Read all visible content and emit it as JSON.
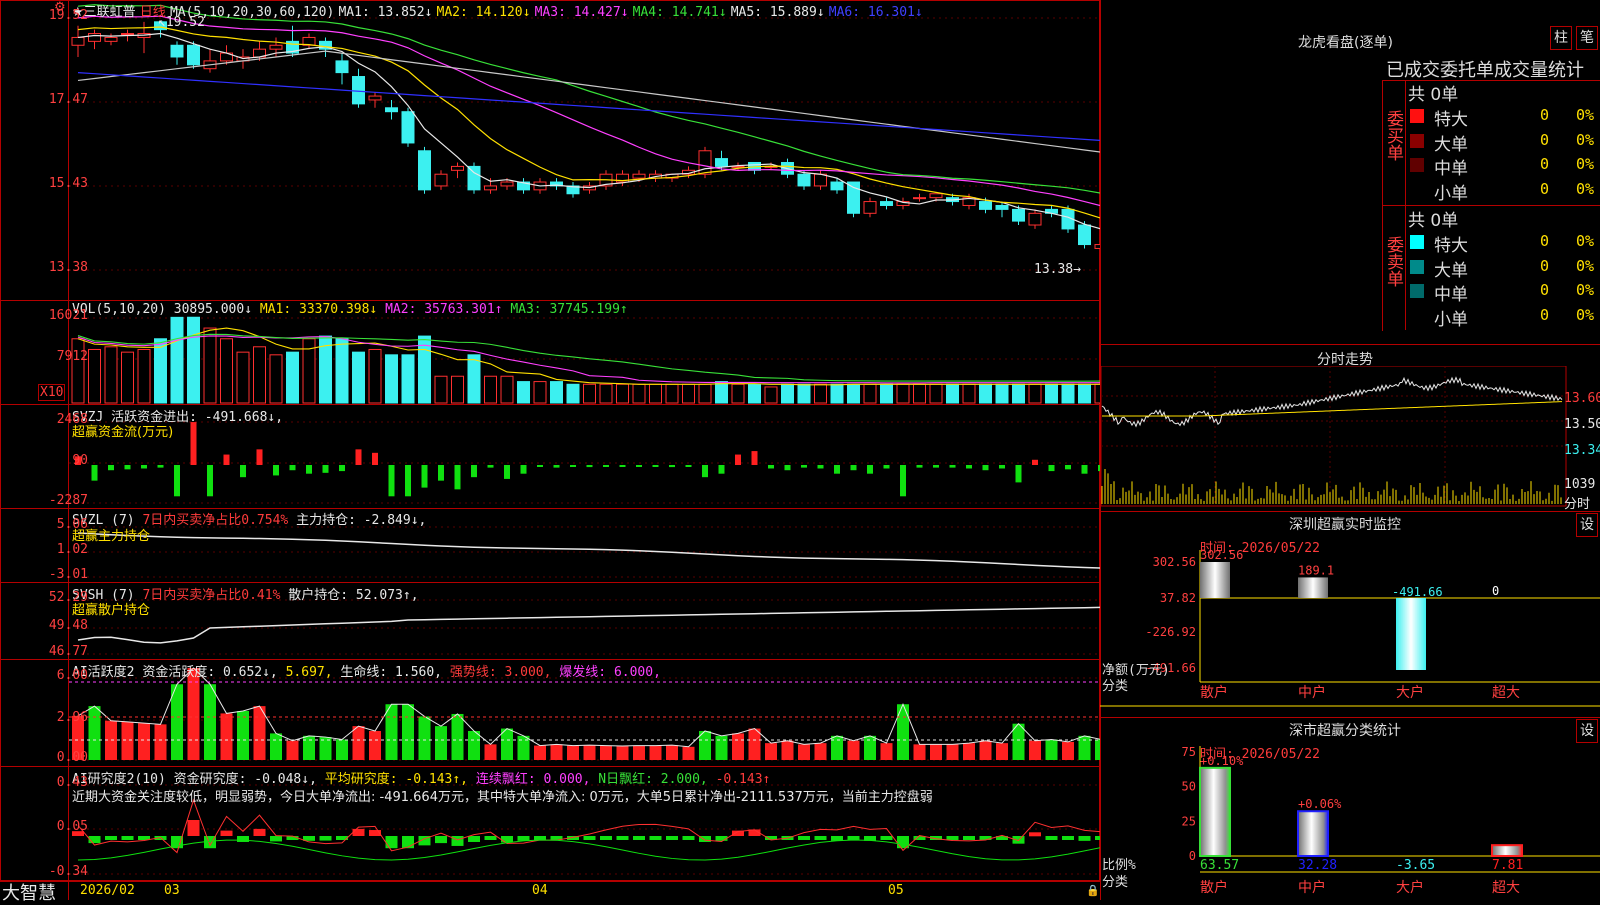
{
  "app": {
    "brand": "大智慧",
    "stock_name": "三联虹普",
    "period": "日线"
  },
  "main": {
    "ma_header": {
      "label": "MA(5,10,20,30,60,120)",
      "ma1": "MA1: 13.852↓",
      "ma2": "MA2: 14.120↓",
      "ma3": "MA3: 14.427↓",
      "ma4": "MA4: 14.741↓",
      "ma5": "MA5: 15.889↓",
      "ma6": "MA6: 16.301↓"
    },
    "y_ticks": [
      "19.52",
      "17.47",
      "15.43",
      "13.38"
    ],
    "high_label": "19.52",
    "low_label": "13.38→"
  },
  "vol": {
    "header": {
      "label": "VOL(5,10,20)",
      "value": "30895.000↓",
      "ma1": "MA1: 33370.398↓",
      "ma2": "MA2: 35763.301↑",
      "ma3": "MA3: 37745.199↑"
    },
    "y_ticks": [
      "16021",
      "7912"
    ],
    "unit": "X10"
  },
  "svzj": {
    "header": {
      "label": "SVZJ",
      "text": "活跃资金进出: -491.668↓,",
      "sub": "超赢资金流(万元)"
    },
    "y_ticks": [
      "2468",
      "90",
      "-2287"
    ]
  },
  "svzl": {
    "header": {
      "label": "SVZL (7)",
      "pct": "7日内买卖净占比0.754%",
      "text": "主力持仓: -2.849↓,",
      "sub": "超赢主力持仓"
    },
    "y_ticks": [
      "5.06",
      "1.02",
      "-3.01"
    ]
  },
  "svsh": {
    "header": {
      "label": "SVSH (7)",
      "pct": "7日内买卖净占比0.41%",
      "text": "散户持仓: 52.073↑,",
      "sub": "超赢散户持仓"
    },
    "y_ticks": [
      "52.29",
      "49.48",
      "46.77"
    ]
  },
  "ai2": {
    "header": {
      "label": "AI活跃度2",
      "t1": "资金活跃度: 0.652↓,",
      "t2": "5.697,",
      "t3": "生命线: 1.560,",
      "t4": "强势线: 3.000,",
      "t5": "爆发线: 6.000,"
    },
    "y_ticks": [
      "6.00",
      "2.96",
      "0.00"
    ]
  },
  "ai_research": {
    "header": {
      "label": "AI研究度2(10)",
      "t1": "资金研究度: -0.048↓,",
      "t2": "平均研究度: -0.143↑,",
      "t3": "连续飘红: 0.000,",
      "t4": "N日飘红: 2.000,",
      "t5": "-0.143↑"
    },
    "comment": "近期大资金关注度较低，明显弱势，今日大单净流出: -491.664万元，其中特大单净流入: 0万元，大单5日累计净出-2111.537万元，当前主力控盘弱",
    "y_ticks": [
      "0.43",
      "0.05",
      "-0.34"
    ]
  },
  "date_axis": [
    "2026/02",
    "03",
    "04",
    "05"
  ],
  "right": {
    "dragon": {
      "title": "龙虎看盘(逐单)",
      "tab1": "柱",
      "tab2": "笔",
      "subtitle": "已成交委托单成交量统计",
      "buy": {
        "side": "委买单",
        "total": "共 0单",
        "rows": [
          {
            "name": "特大",
            "count": "0",
            "pct": "0%",
            "color": "#ff1010"
          },
          {
            "name": "大单",
            "count": "0",
            "pct": "0%",
            "color": "#8a0000"
          },
          {
            "name": "中单",
            "count": "0",
            "pct": "0%",
            "color": "#600000"
          },
          {
            "name": "小单",
            "count": "0",
            "pct": "0%",
            "color": "#000000"
          }
        ]
      },
      "sell": {
        "side": "委卖单",
        "total": "共 0单",
        "rows": [
          {
            "name": "特大",
            "count": "0",
            "pct": "0%",
            "color": "#00ffff"
          },
          {
            "name": "大单",
            "count": "0",
            "pct": "0%",
            "color": "#008a8a"
          },
          {
            "name": "中单",
            "count": "0",
            "pct": "0%",
            "color": "#006a6a"
          },
          {
            "name": "小单",
            "count": "0",
            "pct": "0%",
            "color": "#000000"
          }
        ]
      }
    },
    "intraday": {
      "title": "分时走势",
      "price_ticks": [
        "13.60",
        "13.50",
        "13.34"
      ],
      "vol_tick": "1039",
      "vol_label": "分时"
    },
    "monitor": {
      "title": "深圳超赢实时监控",
      "set": "设",
      "time": "时间: 2026/05/22",
      "y_ticks": [
        "302.56",
        "37.82",
        "-226.92",
        "-491.66"
      ],
      "ylabel1": "净额(万元)",
      "ylabel2": "分类",
      "categories": [
        "散户",
        "中户",
        "大户",
        "超大"
      ],
      "values": [
        302.56,
        189.1,
        -491.66,
        0
      ],
      "value_labels": [
        "302.56",
        "189.1",
        "-491.66",
        "0"
      ]
    },
    "classify": {
      "title": "深市超赢分类统计",
      "set": "设",
      "time": "时间: 2026/05/22",
      "y_ticks": [
        "75",
        "50",
        "25",
        "0"
      ],
      "ylabel1": "比例%",
      "ylabel2": "分类",
      "categories": [
        "散户",
        "中户",
        "大户",
        "超大"
      ],
      "values": [
        63.57,
        32.28,
        -3.65,
        7.81
      ],
      "value_labels": [
        "63.57",
        "32.28",
        "-3.65",
        "7.81"
      ],
      "top_labels": [
        "+0.10%",
        "+0.06%",
        "",
        ""
      ]
    }
  },
  "chart_data": [
    {
      "type": "candlestick",
      "title": "三联虹普 日线",
      "ylim": [
        13.38,
        19.52
      ],
      "candles": [
        [
          18.9,
          19.1,
          19.4,
          18.6
        ],
        [
          19.0,
          19.2,
          19.3,
          18.8
        ],
        [
          19.0,
          19.1,
          19.2,
          18.9
        ],
        [
          19.2,
          19.2,
          19.3,
          19.0
        ],
        [
          19.1,
          19.2,
          19.5,
          18.7
        ],
        [
          19.5,
          19.3,
          19.52,
          19.1
        ],
        [
          18.9,
          18.6,
          19.0,
          18.4
        ],
        [
          18.9,
          18.4,
          19.0,
          18.3
        ],
        [
          18.3,
          18.5,
          18.8,
          18.2
        ],
        [
          18.5,
          18.7,
          18.9,
          18.4
        ],
        [
          18.5,
          18.6,
          18.8,
          18.3
        ],
        [
          18.6,
          18.8,
          19.0,
          18.5
        ],
        [
          18.8,
          18.9,
          19.1,
          18.6
        ],
        [
          19.0,
          18.7,
          19.4,
          18.6
        ],
        [
          18.9,
          19.1,
          19.2,
          18.8
        ],
        [
          19.0,
          18.8,
          19.1,
          18.6
        ],
        [
          18.5,
          18.2,
          18.7,
          17.9
        ],
        [
          18.1,
          17.4,
          18.3,
          17.3
        ],
        [
          17.5,
          17.6,
          17.7,
          17.3
        ],
        [
          17.3,
          17.2,
          17.5,
          17.0
        ],
        [
          17.2,
          16.4,
          17.3,
          16.3
        ],
        [
          16.2,
          15.2,
          16.3,
          15.1
        ],
        [
          15.3,
          15.6,
          15.7,
          15.2
        ],
        [
          15.7,
          15.8,
          15.9,
          15.5
        ],
        [
          15.8,
          15.2,
          15.9,
          15.1
        ],
        [
          15.2,
          15.3,
          15.5,
          15.1
        ],
        [
          15.3,
          15.4,
          15.5,
          15.2
        ],
        [
          15.4,
          15.2,
          15.5,
          15.1
        ],
        [
          15.2,
          15.4,
          15.5,
          15.1
        ],
        [
          15.4,
          15.3,
          15.5,
          15.2
        ],
        [
          15.3,
          15.1,
          15.4,
          15.0
        ],
        [
          15.2,
          15.3,
          15.4,
          15.1
        ],
        [
          15.3,
          15.6,
          15.7,
          15.2
        ],
        [
          15.4,
          15.6,
          15.7,
          15.3
        ],
        [
          15.5,
          15.6,
          15.7,
          15.4
        ],
        [
          15.5,
          15.6,
          15.7,
          15.4
        ],
        [
          15.5,
          15.6,
          15.6,
          15.4
        ],
        [
          15.6,
          15.7,
          15.8,
          15.5
        ],
        [
          15.6,
          16.2,
          16.3,
          15.5
        ],
        [
          16.0,
          15.8,
          16.2,
          15.7
        ],
        [
          15.8,
          15.8,
          15.9,
          15.7
        ],
        [
          15.9,
          15.7,
          15.9,
          15.6
        ],
        [
          15.8,
          15.8,
          15.9,
          15.7
        ],
        [
          15.9,
          15.6,
          16.0,
          15.5
        ],
        [
          15.6,
          15.3,
          15.7,
          15.2
        ],
        [
          15.3,
          15.6,
          15.7,
          15.2
        ],
        [
          15.4,
          15.2,
          15.5,
          15.1
        ],
        [
          15.4,
          14.6,
          15.4,
          14.5
        ],
        [
          14.6,
          14.9,
          15.0,
          14.5
        ],
        [
          14.9,
          14.8,
          15.0,
          14.7
        ],
        [
          14.8,
          14.9,
          15.0,
          14.7
        ],
        [
          15.0,
          15.0,
          15.1,
          14.9
        ],
        [
          15.0,
          15.1,
          15.1,
          14.9
        ],
        [
          15.0,
          14.9,
          15.1,
          14.8
        ],
        [
          14.8,
          15.0,
          15.1,
          14.7
        ],
        [
          14.9,
          14.7,
          15.0,
          14.6
        ],
        [
          14.8,
          14.7,
          14.9,
          14.5
        ],
        [
          14.7,
          14.4,
          14.8,
          14.3
        ],
        [
          14.3,
          14.6,
          14.7,
          14.2
        ],
        [
          14.7,
          14.6,
          14.8,
          14.5
        ],
        [
          14.7,
          14.2,
          14.8,
          14.1
        ],
        [
          14.3,
          13.8,
          14.4,
          13.7
        ],
        [
          13.7,
          13.8,
          13.9,
          13.5
        ]
      ],
      "ma_series": [
        {
          "name": "MA1"
        },
        {
          "name": "MA2"
        },
        {
          "name": "MA3"
        },
        {
          "name": "MA4"
        },
        {
          "name": "MA5"
        },
        {
          "name": "MA6"
        }
      ]
    },
    {
      "type": "bar",
      "title": "VOL(5,10,20)",
      "values": [
        12000,
        10000,
        10500,
        9500,
        10000,
        12000,
        16000,
        16021,
        14000,
        12000,
        9500,
        10500,
        9000,
        9500,
        12000,
        12500,
        12000,
        9500,
        10000,
        9000,
        9000,
        12500,
        5000,
        5000,
        9000,
        5000,
        5000,
        4000,
        4000,
        4000,
        3500,
        3500,
        3500,
        3500,
        3500,
        3500,
        3500,
        3500,
        3500,
        4000,
        3500,
        3500,
        3000,
        3500,
        3500,
        3500,
        3500,
        3500,
        3500,
        3500,
        3500,
        3500,
        3500,
        3500,
        3500,
        3500,
        3500,
        3500,
        3500,
        3500,
        3500,
        3500,
        3500
      ]
    },
    {
      "type": "bar",
      "title": "超赢资金流(万元)",
      "ylim": [
        -2287,
        2468
      ],
      "values": [
        500,
        -900,
        -300,
        -250,
        -200,
        -150,
        -1800,
        2468,
        -1800,
        600,
        -700,
        900,
        -600,
        -300,
        -500,
        -450,
        -350,
        900,
        700,
        -1800,
        -1800,
        -1300,
        -900,
        -1400,
        -700,
        -150,
        -800,
        -500,
        -100,
        -150,
        -100,
        -120,
        -100,
        -80,
        -100,
        -100,
        -120,
        -50,
        -700,
        -500,
        600,
        800,
        -200,
        -300,
        -150,
        -200,
        -500,
        -300,
        -500,
        -200,
        -1800,
        -150,
        -150,
        -150,
        -200,
        -300,
        -200,
        -1000,
        300,
        -350,
        -250,
        -500,
        -350
      ]
    }
  ]
}
